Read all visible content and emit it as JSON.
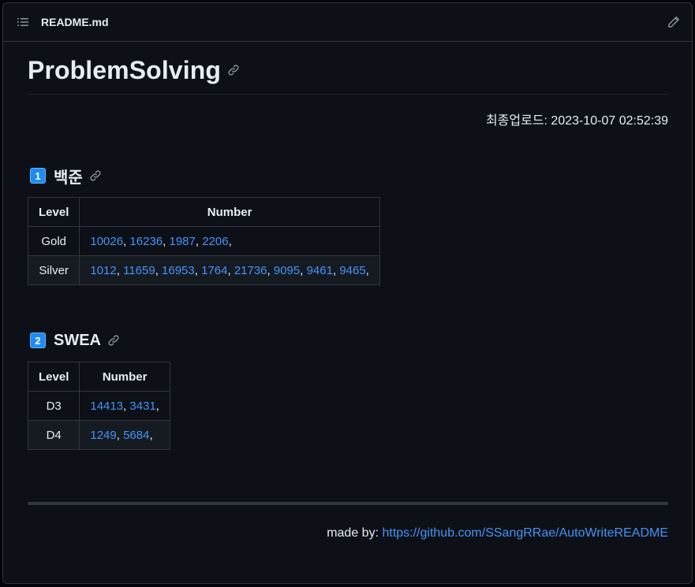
{
  "header": {
    "file_title": "README.md",
    "toc_icon": "list-unordered-icon",
    "edit_icon": "pencil-icon"
  },
  "readme": {
    "title": "ProblemSolving",
    "updated": "최종업로드: 2023-10-07 02:52:39",
    "sections": [
      {
        "badge": "1",
        "heading": "백준",
        "columns": [
          "Level",
          "Number"
        ],
        "rows": [
          {
            "level": "Gold",
            "problems": [
              "10026",
              "16236",
              "1987",
              "2206"
            ]
          },
          {
            "level": "Silver",
            "problems": [
              "1012",
              "11659",
              "16953",
              "1764",
              "21736",
              "9095",
              "9461",
              "9465"
            ]
          }
        ]
      },
      {
        "badge": "2",
        "heading": "SWEA",
        "columns": [
          "Level",
          "Number"
        ],
        "rows": [
          {
            "level": "D3",
            "problems": [
              "14413",
              "3431"
            ]
          },
          {
            "level": "D4",
            "problems": [
              "1249",
              "5684"
            ]
          }
        ]
      }
    ],
    "footer": {
      "label": "made by: ",
      "link_text": "https://github.com/SSangRRae/AutoWriteREADME"
    }
  },
  "colors": {
    "background": "#0d1117",
    "border": "#30363d",
    "link": "#4493f8",
    "badge": "#1f8bf0"
  }
}
